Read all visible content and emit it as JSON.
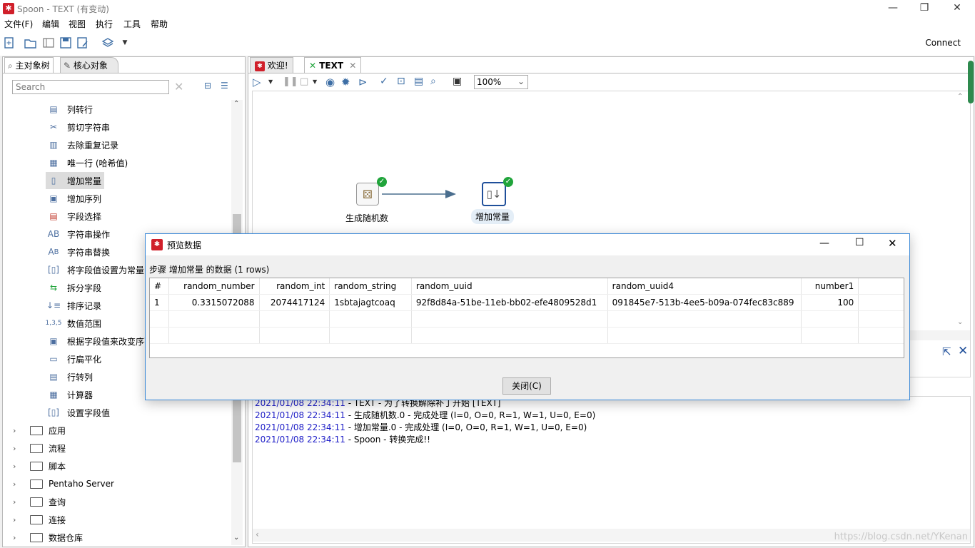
{
  "window": {
    "title": "Spoon - TEXT (有变动)"
  },
  "menu": [
    "文件(F)",
    "编辑",
    "视图",
    "执行",
    "工具",
    "帮助"
  ],
  "toolbar": {
    "connect": "Connect"
  },
  "left": {
    "tabs": [
      "主对象树",
      "核心对象"
    ],
    "search_placeholder": "Search",
    "items": [
      "列转行",
      "剪切字符串",
      "去除重复记录",
      "唯一行 (哈希值)",
      "增加常量",
      "增加序列",
      "字段选择",
      "字符串操作",
      "字符串替换",
      "将字段值设置为常量",
      "拆分字段",
      "排序记录",
      "数值范围",
      "根据字段值来改变序列",
      "行扁平化",
      "行转列",
      "计算器",
      "设置字段值"
    ],
    "folders": [
      "应用",
      "流程",
      "脚本",
      "Pentaho Server",
      "查询",
      "连接",
      "数据仓库"
    ]
  },
  "tabs": [
    {
      "label": "欢迎!"
    },
    {
      "label": "TEXT"
    }
  ],
  "canvas_toolbar": {
    "zoom": "100%"
  },
  "canvas": {
    "steps": [
      {
        "label": "生成随机数"
      },
      {
        "label": "增加常量"
      }
    ]
  },
  "log": [
    {
      "ts": "2021/01/08 22:34:11",
      "msg": " - TEXT - 为了转换解除补丁开始 [TEXT]"
    },
    {
      "ts": "2021/01/08 22:34:11",
      "msg": " - 生成随机数.0 - 完成处理 (I=0, O=0, R=1, W=1, U=0, E=0)"
    },
    {
      "ts": "2021/01/08 22:34:11",
      "msg": " - 增加常量.0 - 完成处理 (I=0, O=0, R=1, W=1, U=0, E=0)"
    },
    {
      "ts": "2021/01/08 22:34:11",
      "msg": " - Spoon - 转换完成!!"
    }
  ],
  "dialog": {
    "title": "预览数据",
    "subtitle": "步骤 增加常量 的数据  (1 rows)",
    "columns": [
      "#",
      "random_number",
      "random_int",
      "random_string",
      "random_uuid",
      "random_uuid4",
      "number1"
    ],
    "rows": [
      [
        "1",
        "0.3315072088",
        "2074417124",
        "1sbtajagtcoaq",
        "92f8d84a-51be-11eb-bb02-efe4809528d1",
        "091845e7-513b-4ee5-b09a-074fec83c889",
        "100"
      ]
    ],
    "close": "关闭(C)"
  },
  "watermark": "https://blog.csdn.net/YKenan",
  "colors": {
    "accent": "#d01f2a",
    "log_timestamp": "#2020c8",
    "ok": "#20a43b",
    "dialog_border": "#3c8ad8"
  }
}
